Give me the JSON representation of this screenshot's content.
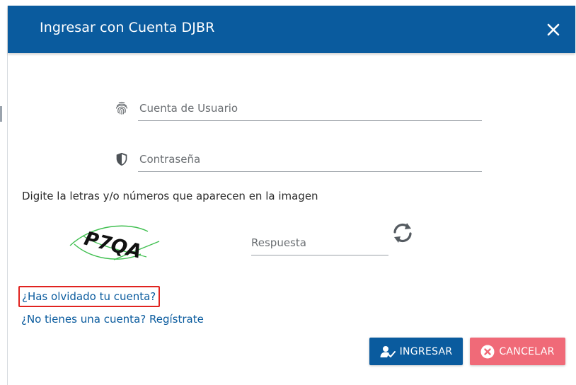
{
  "modal": {
    "title": "Ingresar con Cuenta DJBR",
    "close_icon": "close-icon"
  },
  "form": {
    "username": {
      "placeholder": "Cuenta de Usuario",
      "value": "",
      "icon": "fingerprint-icon"
    },
    "password": {
      "placeholder": "Contraseña",
      "value": "",
      "icon": "shield-icon"
    },
    "captcha": {
      "instruction": "Digite la letras y/o números que aparecen en la imagen",
      "image_text": "P7QA",
      "answer_placeholder": "Respuesta",
      "answer_value": "",
      "refresh_icon": "refresh-icon"
    }
  },
  "links": {
    "forgot": "¿Has olvidado tu cuenta?",
    "register": "¿No tienes una cuenta? Regístrate"
  },
  "buttons": {
    "login_label": "INGRESAR",
    "login_icon": "user-check-icon",
    "cancel_label": "CANCELAR",
    "cancel_icon": "times-circle-icon"
  },
  "colors": {
    "primary": "#0a5b9e",
    "cancel": "#f06a78",
    "highlight_border": "#e0231f"
  }
}
